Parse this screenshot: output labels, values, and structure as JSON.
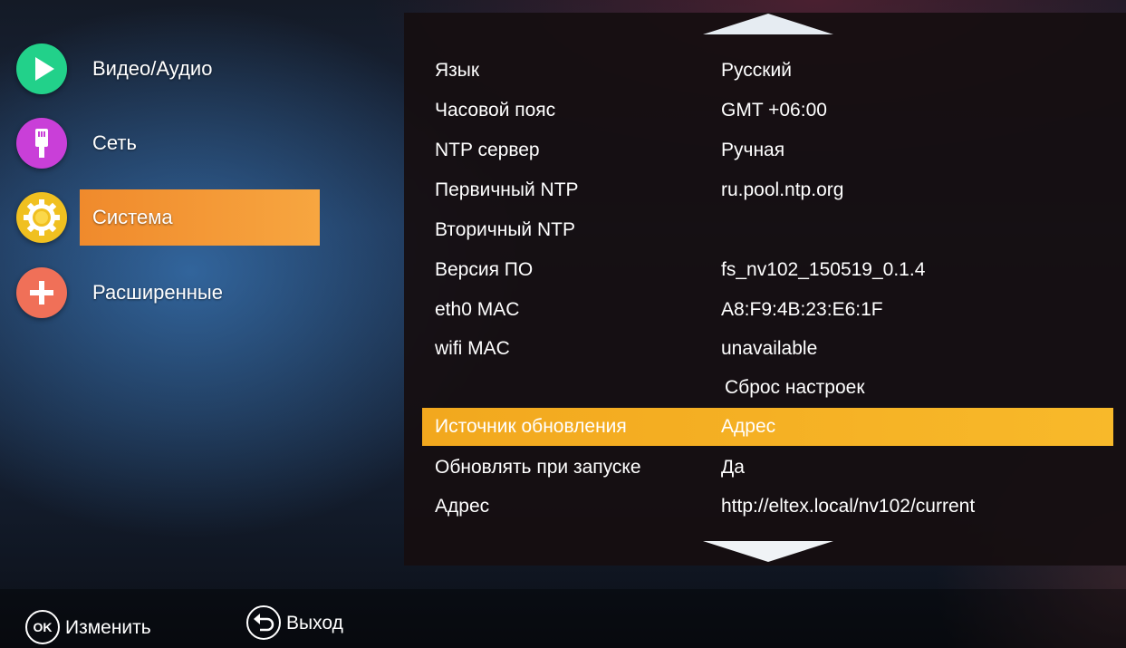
{
  "sidebar": {
    "items": [
      {
        "label": "Видео/Аудио",
        "icon": "play-icon",
        "color": "#22d18a"
      },
      {
        "label": "Сеть",
        "icon": "network-plug-icon",
        "color": "#c93fd8"
      },
      {
        "label": "Система",
        "icon": "gear-icon",
        "color": "#f0c020",
        "active": true
      },
      {
        "label": "Расширенные",
        "icon": "plus-icon",
        "color": "#f07058"
      }
    ]
  },
  "settings": {
    "rows": [
      {
        "key": "Язык",
        "value": "Русский"
      },
      {
        "key": "Часовой пояс",
        "value": "GMT +06:00"
      },
      {
        "key": "NTP сервер",
        "value": "Ручная"
      },
      {
        "key": "Первичный NTP",
        "value": "ru.pool.ntp.org"
      },
      {
        "key": "Вторичный NTP",
        "value": ""
      },
      {
        "key": "Версия ПО",
        "value": "fs_nv102_150519_0.1.4"
      },
      {
        "key": "eth0 MAC",
        "value": "A8:F9:4B:23:E6:1F"
      },
      {
        "key": "wifi MAC",
        "value": "unavailable"
      },
      {
        "key": "",
        "value": "Сброс настроек"
      },
      {
        "key": "Источник обновления",
        "value": "Адрес",
        "selected": true
      },
      {
        "key": "Обновлять при запуске",
        "value": "Да"
      },
      {
        "key": "Адрес",
        "value": "http://eltex.local/nv102/current"
      }
    ]
  },
  "footer": {
    "ok_glyph": "OK",
    "ok_label": "Изменить",
    "back_icon": "back-arrow-icon",
    "back_label": "Выход"
  },
  "colors": {
    "accent_menu": "#f08a2c",
    "accent_row": "#f2a81e"
  }
}
